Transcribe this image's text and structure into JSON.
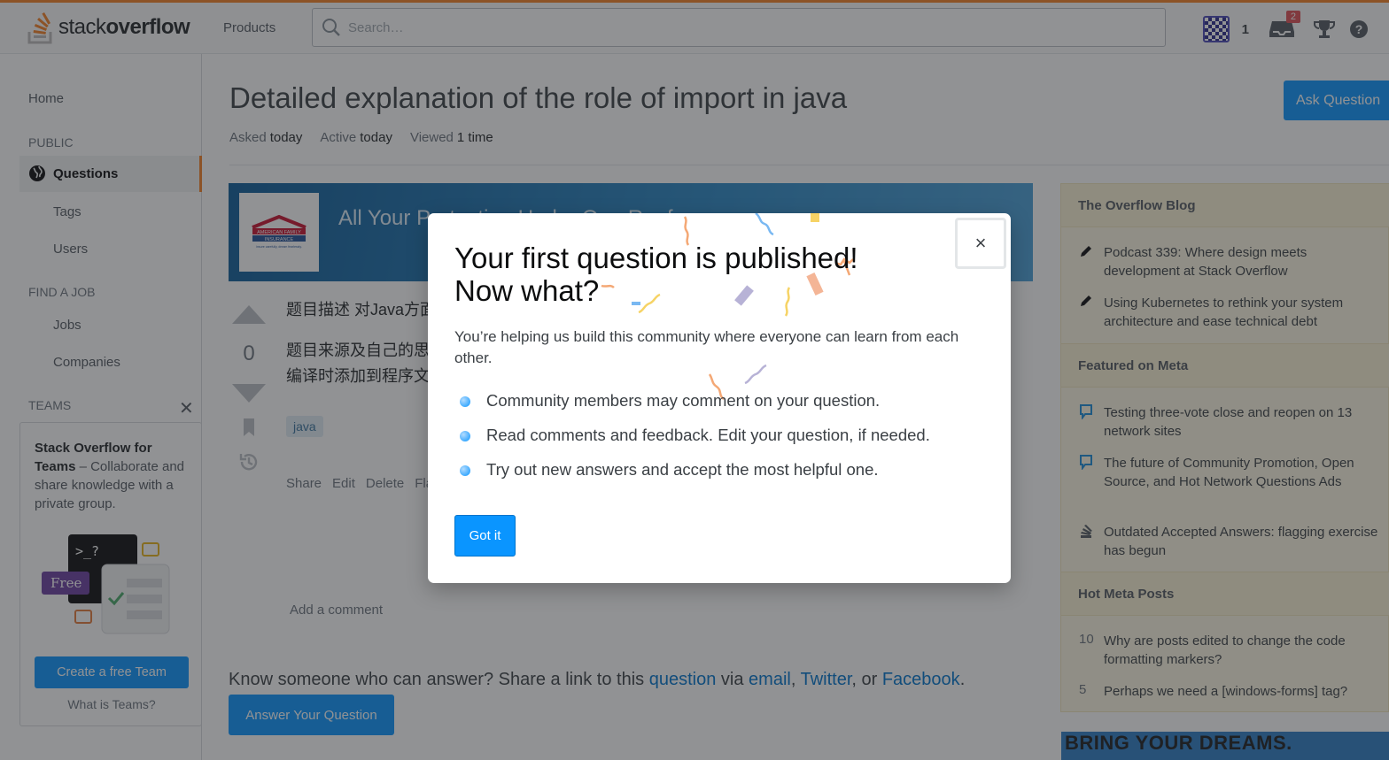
{
  "header": {
    "logo_text_light": "stack",
    "logo_text_bold": "overflow",
    "products_label": "Products",
    "search_placeholder": "Search…",
    "reputation": "1",
    "inbox_badge": "2"
  },
  "leftnav": {
    "home": "Home",
    "public_section": "PUBLIC",
    "questions": "Questions",
    "tags": "Tags",
    "users": "Users",
    "find_job_section": "FIND A JOB",
    "jobs": "Jobs",
    "companies": "Companies",
    "teams_section": "TEAMS",
    "teams_title": "Stack Overflow for Teams",
    "teams_desc": " – Collaborate and share knowledge with a private group.",
    "free_badge": "Free",
    "terminal_text": ">_?",
    "create_team": "Create a free Team",
    "what_is_teams": "What is Teams?"
  },
  "question": {
    "title": "Detailed explanation of the role of import in java",
    "asked_label": "Asked",
    "asked_value": "today",
    "active_label": "Active",
    "active_value": "today",
    "viewed_label": "Viewed",
    "viewed_value": "1 time",
    "ask_button": "Ask Question",
    "ad_text": "All Your Protection Under One Roof",
    "ad_logo_line1": "AMERICAN FAMILY",
    "ad_logo_line2": "INSURANCE",
    "ad_logo_tagline": "insure carefully, dream fearlessly.",
    "vote_count": "0",
    "body_line1": "题目描述 对Java方面",
    "body_line2": "题目来源及自己的思",
    "body_line3": "编译时添加到程序文",
    "tag": "java",
    "actions": [
      "Share",
      "Edit",
      "Delete",
      "Flag"
    ],
    "add_comment": "Add a comment",
    "share_prefix": "Know someone who can answer? Share a link to this ",
    "share_question": "question",
    "share_via": " via ",
    "share_email": "email",
    "share_comma": ", ",
    "share_twitter": "Twitter",
    "share_or": ", or ",
    "share_facebook": "Facebook",
    "share_end": ".",
    "answer_button": "Answer Your Question"
  },
  "sidebar": {
    "blog_heading": "The Overflow Blog",
    "blog_items": [
      "Podcast 339: Where design meets development at Stack Overflow",
      "Using Kubernetes to rethink your system architecture and ease technical debt"
    ],
    "meta_heading": "Featured on Meta",
    "meta_items": [
      "Testing three-vote close and reopen on 13 network sites",
      "The future of Community Promotion, Open Source, and Hot Network Questions Ads",
      "Outdated Accepted Answers: flagging exercise has begun"
    ],
    "hot_heading": "Hot Meta Posts",
    "hot_items": [
      {
        "count": "10",
        "text": "Why are posts edited to change the code formatting markers?"
      },
      {
        "count": "5",
        "text": "Perhaps we need a [windows-forms] tag?"
      }
    ],
    "ad_text": "BRING YOUR DREAMS."
  },
  "modal": {
    "title_line1": "Your first question is published!",
    "title_line2": "Now what?",
    "subtitle": "You’re helping us build this community where everyone can learn from each other.",
    "bullets": [
      "Community members may comment on your question.",
      "Read comments and feedback. Edit your question, if needed.",
      "Try out new answers and accept the most helpful one."
    ],
    "got_it": "Got it",
    "close_glyph": "×"
  },
  "colors": {
    "accent": "#f48024",
    "primary": "#0a95ff",
    "link": "#0074cc",
    "sidebar_bg": "#fdf7e2"
  }
}
